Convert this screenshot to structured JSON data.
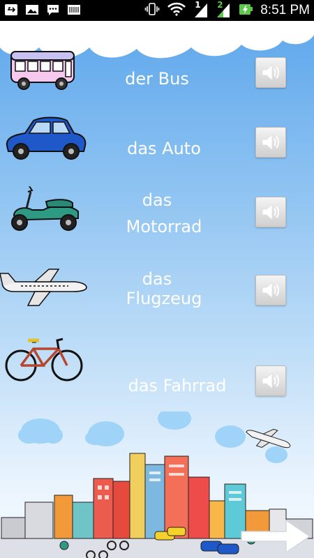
{
  "status_bar": {
    "time": "8:51 PM",
    "sim1": "1",
    "sim2": "2",
    "icons": [
      "usb-icon",
      "image-icon",
      "chat-icon",
      "keyboard-icon",
      "vibrate-icon",
      "wifi-icon",
      "signal-1-icon",
      "signal-2-icon",
      "battery-charging-icon"
    ]
  },
  "vocabulary": [
    {
      "vehicle_icon": "bus-icon",
      "word": "der Bus",
      "speaker_icon": "speaker-icon"
    },
    {
      "vehicle_icon": "car-icon",
      "word": "das Auto",
      "speaker_icon": "speaker-icon"
    },
    {
      "vehicle_icon": "scooter-icon",
      "word_line1": "das",
      "word_line2": "Motorrad",
      "speaker_icon": "speaker-icon"
    },
    {
      "vehicle_icon": "airplane-icon",
      "word_line1": "das",
      "word_line2": "Flugzeug",
      "speaker_icon": "speaker-icon"
    },
    {
      "vehicle_icon": "bicycle-icon",
      "word": "das Fahrrad",
      "speaker_icon": "speaker-icon"
    }
  ],
  "navigation": {
    "next_icon": "next-arrow-icon"
  },
  "colors": {
    "sky_top": "#5ea7ec",
    "sky_bottom": "#f7fbff",
    "word_text": "#ffffff",
    "speaker_bg": "#e3e3e3"
  }
}
